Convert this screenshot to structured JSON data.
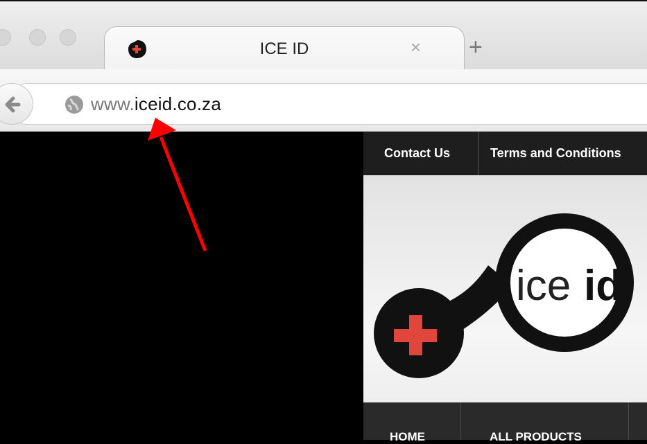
{
  "browser": {
    "tab": {
      "title": "ICE ID",
      "close_glyph": "×"
    },
    "new_tab_glyph": "+",
    "address": {
      "prefix": "www.",
      "domain": "iceid",
      "suffix": ".co.za"
    },
    "icons": [
      "back-arrow-icon",
      "globe-icon",
      "favicon-icon",
      "close-icon",
      "plus-icon"
    ]
  },
  "site": {
    "top_nav": {
      "contact": "Contact Us",
      "terms": "Terms and Conditions"
    },
    "logo": {
      "text_light": "ice",
      "text_bold": "id"
    },
    "main_nav": {
      "home": "HOME",
      "all_products": "ALL PRODUCTS"
    }
  },
  "colors": {
    "accent_red": "#e0463b",
    "annotation_red": "#ff0000",
    "logo_black": "#111111"
  }
}
